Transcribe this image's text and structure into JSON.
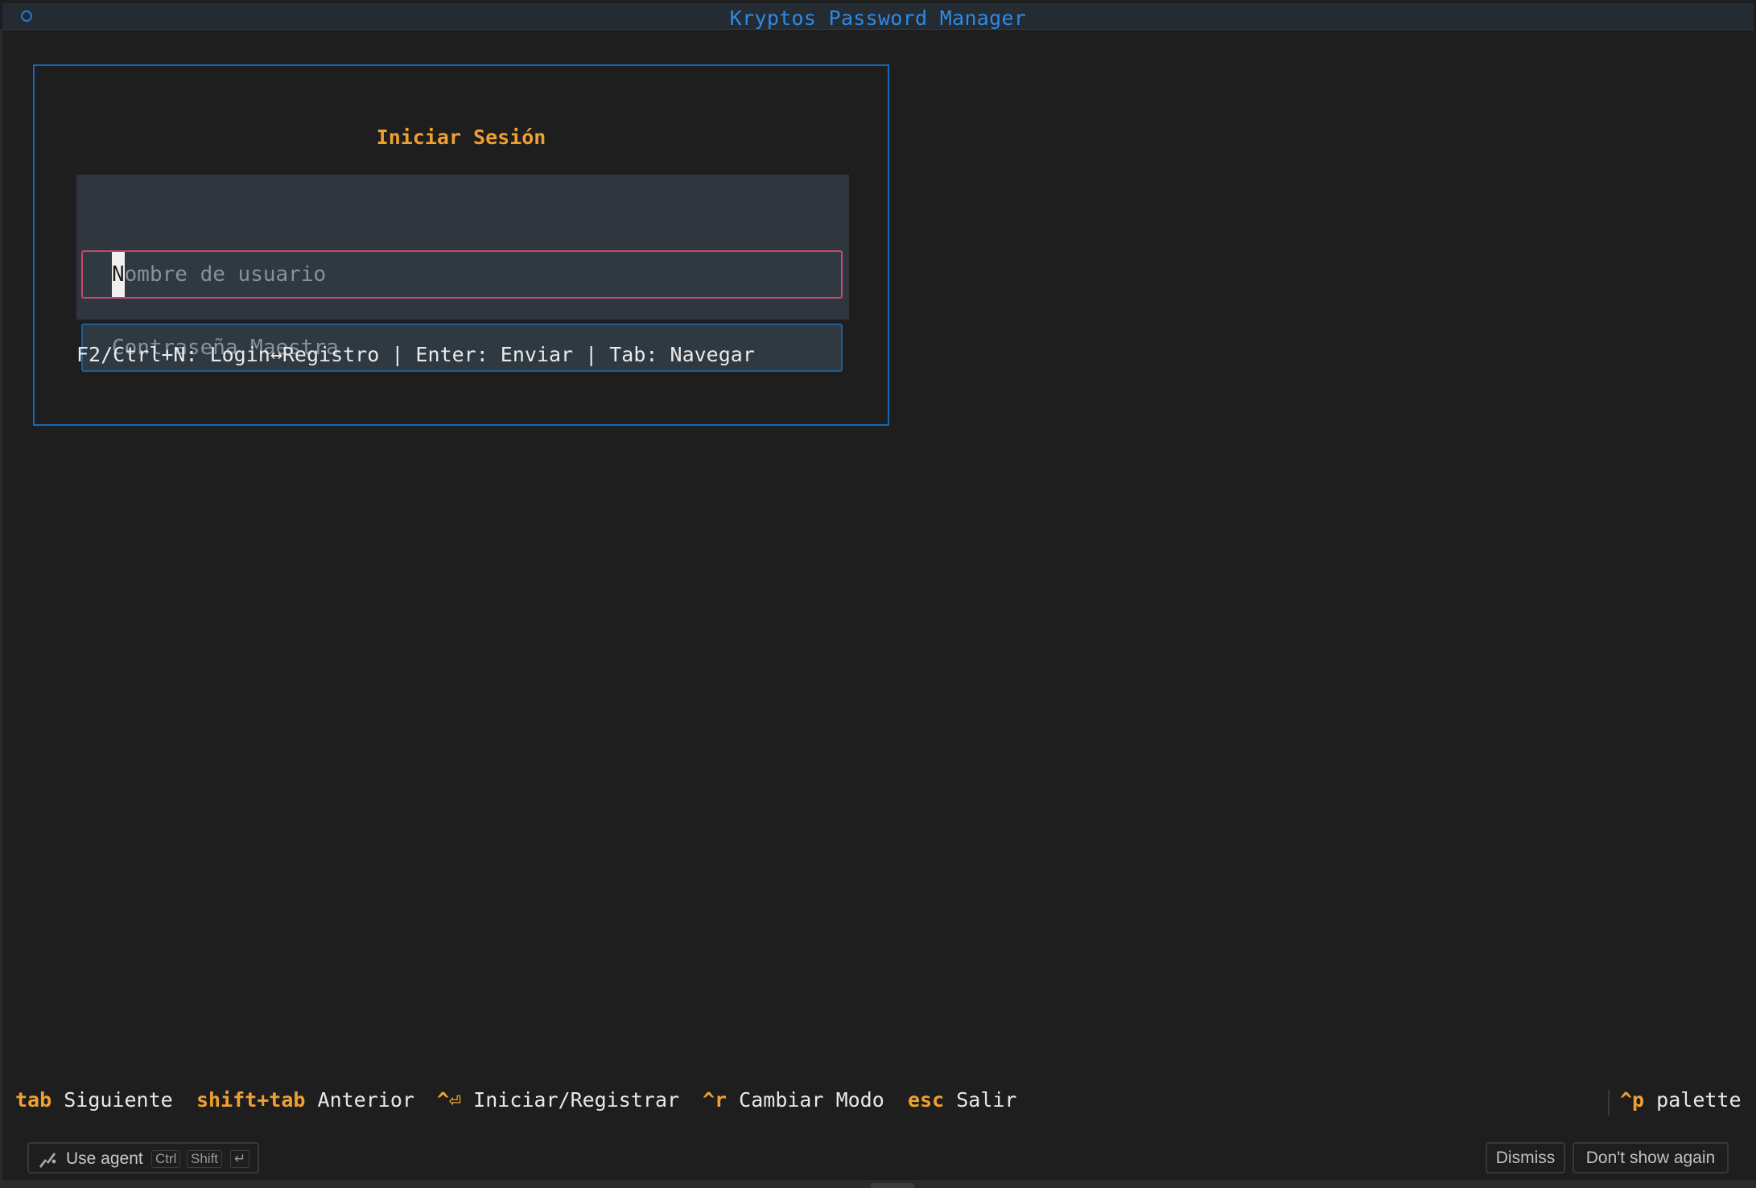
{
  "window": {
    "title": "Kryptos Password Manager"
  },
  "login": {
    "heading": "Iniciar Sesión",
    "username": {
      "placeholder_first": "N",
      "placeholder_rest": "ombre de usuario"
    },
    "password": {
      "placeholder": "Contraseña Maestra"
    },
    "hint": "F2/Ctrl+N: Login↔Registro | Enter: Enviar | Tab: Navegar"
  },
  "footer": {
    "bindings": [
      {
        "key": "tab",
        "desc": "Siguiente"
      },
      {
        "key": "shift+tab",
        "desc": "Anterior"
      },
      {
        "key": "^⏎",
        "desc": "Iniciar/Registrar"
      },
      {
        "key": "^r",
        "desc": "Cambiar Modo"
      },
      {
        "key": "esc",
        "desc": "Salir"
      }
    ],
    "palette": {
      "key": "^p",
      "desc": "palette"
    }
  },
  "notification": {
    "agent_label": "Use agent",
    "keys": [
      "Ctrl",
      "Shift",
      "↵"
    ],
    "dismiss": "Dismiss",
    "dont_show": "Don't show again"
  },
  "colors": {
    "accent_blue": "#1768b3",
    "key_orange": "#f0a030",
    "focus_border": "#c9486e",
    "background": "#1e1e1e"
  },
  "icons": {
    "window": "circle-icon",
    "agent": "agent-icon"
  }
}
